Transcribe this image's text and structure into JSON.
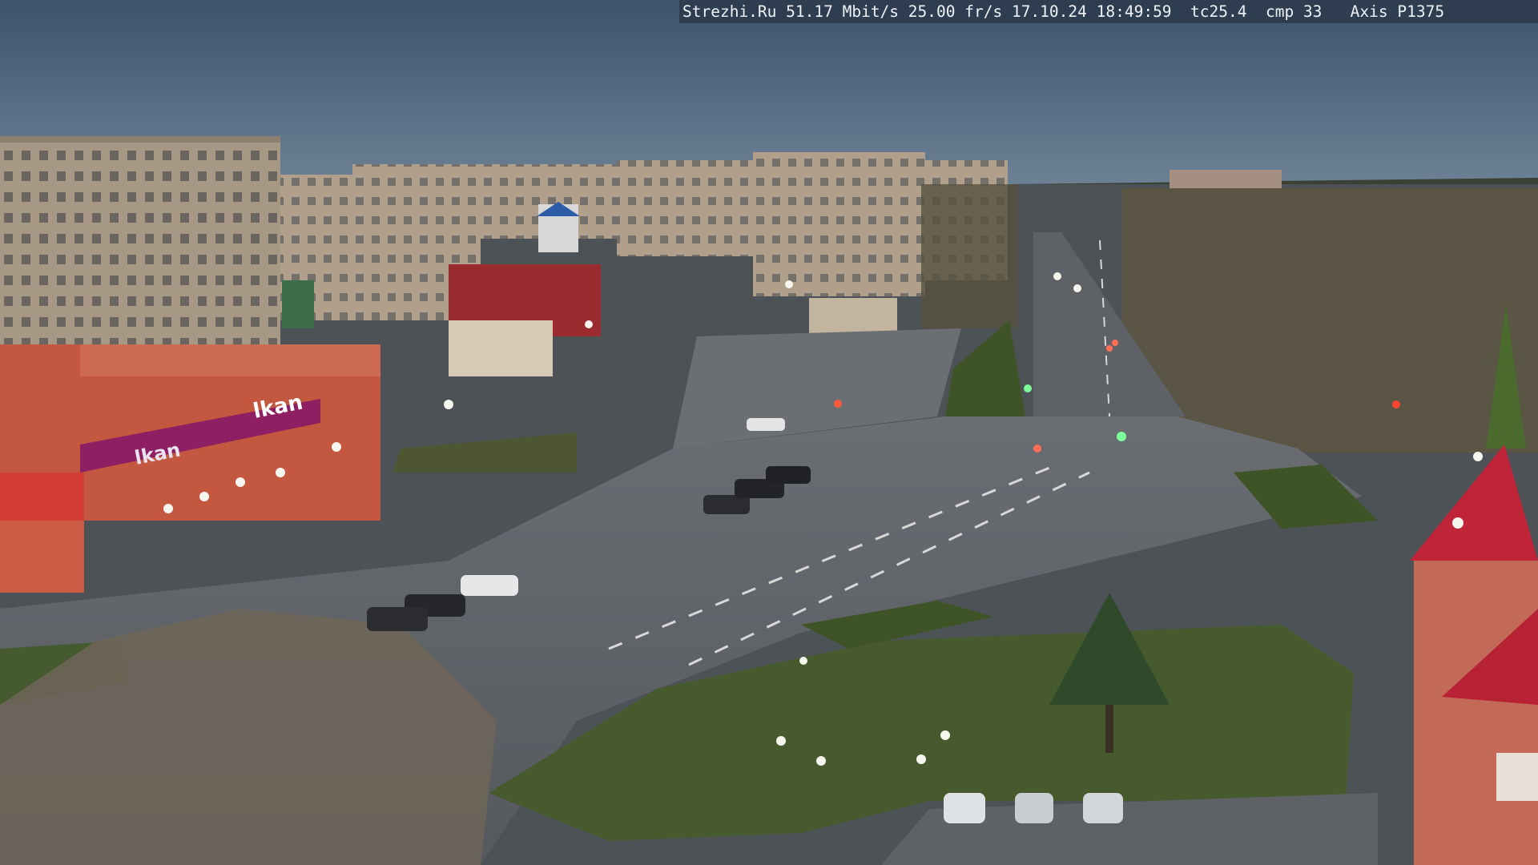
{
  "camera_overlay": {
    "site": "Strezhi.Ru",
    "bitrate": "51.17 Mbit/s",
    "framerate": "25.00 fr/s",
    "date": "17.10.24",
    "time": "18:49:59",
    "tc": "tc25.4",
    "cmp": "cmp 33",
    "model": "Axis P1375"
  },
  "signs": {
    "store_sign": "lkan",
    "store_sign_lower": "lkan"
  },
  "colors": {
    "sky_top": "#3f5670",
    "sky_bottom": "#6a7f92",
    "road": "#5f6368",
    "grass": "#465a2e",
    "building_tan": "#a99a88",
    "building_red": "#c44a3c",
    "store_magenta": "#8e1f63",
    "overlay_bg": "#2e3d4f"
  }
}
